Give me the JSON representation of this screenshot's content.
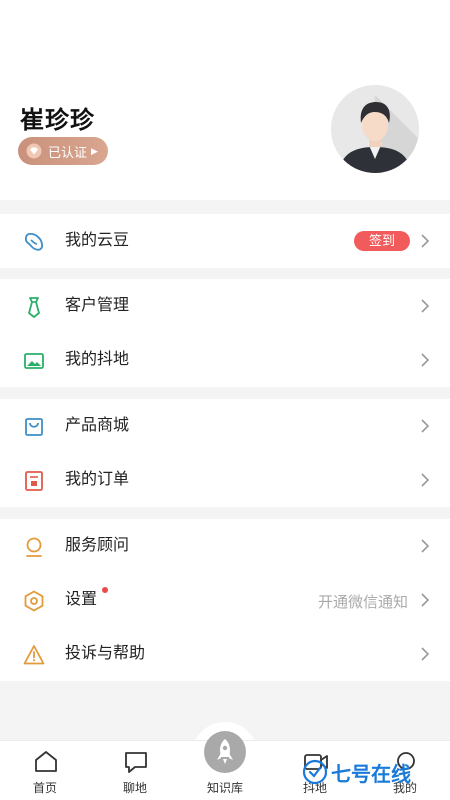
{
  "profile": {
    "name": "崔珍珍",
    "verified_label": "已认证"
  },
  "sections": [
    {
      "items": [
        {
          "icon": "bean-icon",
          "label": "我的云豆",
          "badge": "签到"
        }
      ]
    },
    {
      "items": [
        {
          "icon": "tie-icon",
          "label": "客户管理"
        },
        {
          "icon": "image-icon",
          "label": "我的抖地"
        }
      ]
    },
    {
      "items": [
        {
          "icon": "bag-icon",
          "label": "产品商城"
        },
        {
          "icon": "order-icon",
          "label": "我的订单"
        }
      ]
    },
    {
      "items": [
        {
          "icon": "advisor-icon",
          "label": "服务顾问"
        },
        {
          "icon": "settings-icon",
          "label": "设置",
          "right_text": "开通微信通知",
          "has_dot": true
        },
        {
          "icon": "warning-icon",
          "label": "投诉与帮助"
        }
      ]
    }
  ],
  "tabbar": [
    {
      "icon": "home-icon",
      "label": "首页"
    },
    {
      "icon": "chat-icon",
      "label": "聊地"
    },
    {
      "icon": "rocket-icon",
      "label": "知识库"
    },
    {
      "icon": "video-icon",
      "label": "抖地"
    },
    {
      "icon": "user-icon",
      "label": "我的"
    }
  ],
  "watermark": "七号在线",
  "colors": {
    "accent_red": "#f25b5b",
    "badge_gold": "#c9917b",
    "watermark_blue": "#1a7ad9"
  }
}
